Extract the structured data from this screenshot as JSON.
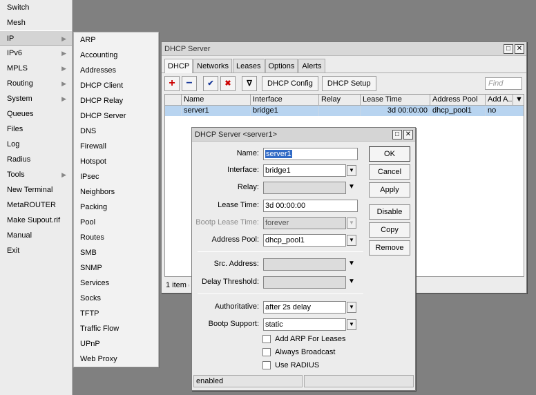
{
  "main_menu": [
    {
      "label": "Switch",
      "has_submenu": false
    },
    {
      "label": "Mesh",
      "has_submenu": false
    },
    {
      "label": "IP",
      "has_submenu": true,
      "active": true
    },
    {
      "label": "IPv6",
      "has_submenu": true
    },
    {
      "label": "MPLS",
      "has_submenu": true
    },
    {
      "label": "Routing",
      "has_submenu": true
    },
    {
      "label": "System",
      "has_submenu": true
    },
    {
      "label": "Queues",
      "has_submenu": false
    },
    {
      "label": "Files",
      "has_submenu": false
    },
    {
      "label": "Log",
      "has_submenu": false
    },
    {
      "label": "Radius",
      "has_submenu": false
    },
    {
      "label": "Tools",
      "has_submenu": true
    },
    {
      "label": "New Terminal",
      "has_submenu": false
    },
    {
      "label": "MetaROUTER",
      "has_submenu": false
    },
    {
      "label": "Make Supout.rif",
      "has_submenu": false
    },
    {
      "label": "Manual",
      "has_submenu": false
    },
    {
      "label": "Exit",
      "has_submenu": false
    }
  ],
  "submenu": [
    "ARP",
    "Accounting",
    "Addresses",
    "DHCP Client",
    "DHCP Relay",
    "DHCP Server",
    "DNS",
    "Firewall",
    "Hotspot",
    "IPsec",
    "Neighbors",
    "Packing",
    "Pool",
    "Routes",
    "SMB",
    "SNMP",
    "Services",
    "Socks",
    "TFTP",
    "Traffic Flow",
    "UPnP",
    "Web Proxy"
  ],
  "dhcp_window": {
    "title": "DHCP Server",
    "tabs": [
      "DHCP",
      "Networks",
      "Leases",
      "Options",
      "Alerts"
    ],
    "toolbar": {
      "add_icon": "+",
      "remove_icon": "−",
      "enable_icon": "✔",
      "disable_icon": "✖",
      "filter_icon": "∇",
      "dhcp_config_label": "DHCP Config",
      "dhcp_setup_label": "DHCP Setup",
      "find_placeholder": "Find"
    },
    "columns": [
      "Name",
      "Interface",
      "Relay",
      "Lease Time",
      "Address Pool",
      "Add A..."
    ],
    "rows": [
      {
        "name": "server1",
        "interface": "bridge1",
        "relay": "",
        "lease_time": "3d 00:00:00",
        "address_pool": "dhcp_pool1",
        "add_arp": "no"
      }
    ],
    "status": "1 item ("
  },
  "dialog": {
    "title": "DHCP Server <server1>",
    "fields": {
      "name": {
        "label": "Name:",
        "value": "server1"
      },
      "interface": {
        "label": "Interface:",
        "value": "bridge1"
      },
      "relay": {
        "label": "Relay:",
        "value": ""
      },
      "lease_time": {
        "label": "Lease Time:",
        "value": "3d 00:00:00"
      },
      "bootp_lease_time": {
        "label": "Bootp Lease Time:",
        "value": "forever"
      },
      "address_pool": {
        "label": "Address Pool:",
        "value": "dhcp_pool1"
      },
      "src_address": {
        "label": "Src. Address:",
        "value": ""
      },
      "delay_threshold": {
        "label": "Delay Threshold:",
        "value": ""
      },
      "authoritative": {
        "label": "Authoritative:",
        "value": "after 2s delay"
      },
      "bootp_support": {
        "label": "Bootp Support:",
        "value": "static"
      }
    },
    "checkboxes": [
      {
        "label": "Add ARP For Leases",
        "checked": false
      },
      {
        "label": "Always Broadcast",
        "checked": false
      },
      {
        "label": "Use RADIUS",
        "checked": false
      }
    ],
    "buttons": {
      "ok": "OK",
      "cancel": "Cancel",
      "apply": "Apply",
      "disable": "Disable",
      "copy": "Copy",
      "remove": "Remove"
    },
    "status": "enabled"
  },
  "window_buttons": {
    "restore": "□",
    "close": "✕"
  }
}
